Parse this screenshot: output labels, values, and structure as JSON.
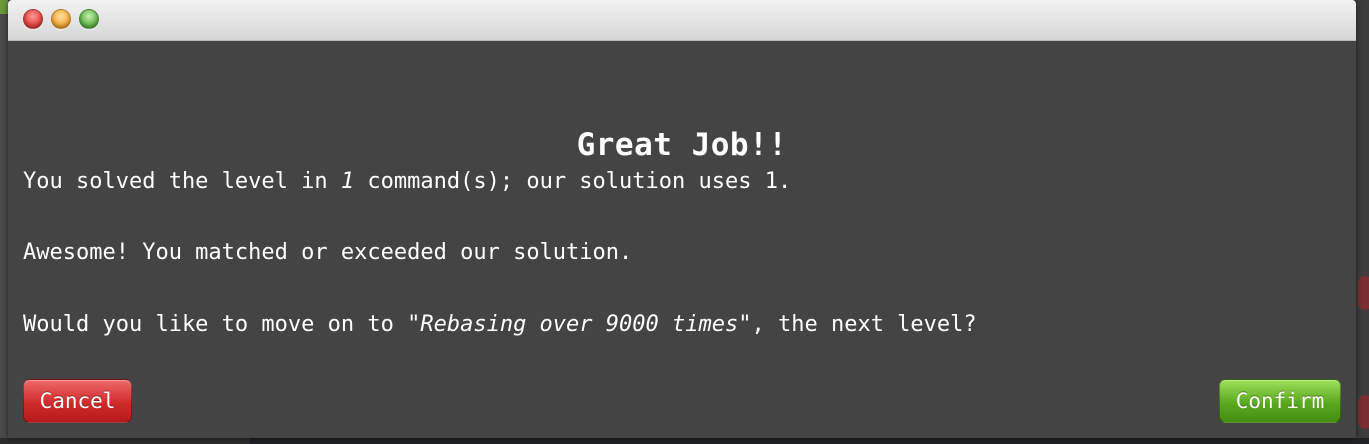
{
  "dialog": {
    "title": "Great Job!!",
    "line1": {
      "prefix": "You solved the level in ",
      "player_count": "1",
      "suffix": " command(s); our solution uses 1."
    },
    "line2": "Awesome! You matched or exceeded our solution.",
    "line3": {
      "prefix": "Would you like to move on to ",
      "next_level": "\"Rebasing over 9000 times\"",
      "suffix": ", the next level?"
    },
    "buttons": {
      "cancel_label": "Cancel",
      "confirm_label": "Confirm"
    }
  },
  "window_controls": {
    "close_icon": "close-icon",
    "minimize_icon": "minimize-icon",
    "zoom_icon": "zoom-icon"
  },
  "colors": {
    "modal_background": "#444444",
    "cancel_button": "#d02a2a",
    "confirm_button": "#5aa81f",
    "text": "#ffffff"
  }
}
